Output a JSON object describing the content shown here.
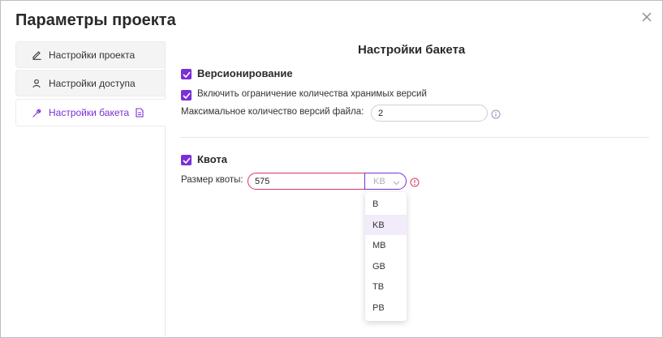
{
  "dialog": {
    "title": "Параметры проекта",
    "close_icon": "close-icon"
  },
  "sidebar": {
    "items": [
      {
        "label": "Настройки проекта",
        "icon": "pencil-icon",
        "active": false
      },
      {
        "label": "Настройки доступа",
        "icon": "user-icon",
        "active": false
      },
      {
        "label": "Настройки бакета",
        "icon": "wrench-icon",
        "active": true,
        "extra_icon": "document-icon"
      }
    ]
  },
  "main": {
    "section_title": "Настройки бакета",
    "versioning": {
      "label": "Версионирование",
      "checked": true,
      "limit_label": "Включить ограничение количества хранимых версий",
      "limit_checked": true,
      "max_versions_label": "Максимальное количество версий файла:",
      "max_versions_value": "2"
    },
    "quota": {
      "label": "Квота",
      "checked": true,
      "size_label": "Размер квоты:",
      "size_value": "575",
      "unit_selected": "KB",
      "unit_options": [
        "B",
        "KB",
        "MB",
        "GB",
        "TB",
        "PB"
      ],
      "highlighted_option": "KB"
    }
  },
  "colors": {
    "accent": "#7b2fd6",
    "error": "#d8365e",
    "highlight": "#f1ebfa"
  }
}
